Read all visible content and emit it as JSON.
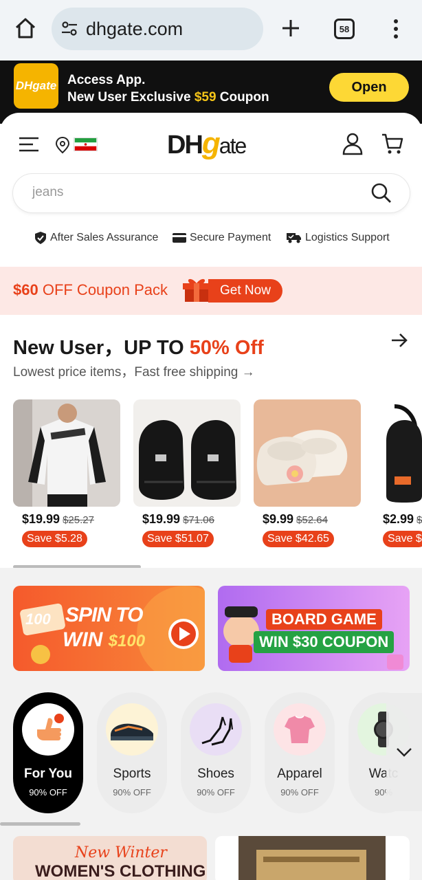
{
  "browser": {
    "url": "dhgate.com",
    "tab_count": "58"
  },
  "app_banner": {
    "logo_text": "DHgate",
    "line1": "Access App.",
    "line2_prefix": "New User Exclusive ",
    "line2_amount": "$59",
    "line2_suffix": " Coupon",
    "open_label": "Open"
  },
  "header": {
    "logo_dh": "DH",
    "logo_g": "g",
    "logo_ate": "ate",
    "search_placeholder": "jeans",
    "assurances": [
      "After Sales Assurance",
      "Secure Payment",
      "Logistics Support"
    ]
  },
  "coupon_strip": {
    "amount": "$60",
    "text": " OFF Coupon Pack",
    "cta": "Get Now"
  },
  "new_user": {
    "title_prefix": "New User，UP TO ",
    "title_pct": "50% Off",
    "subtitle": "Lowest price items，Fast free shipping →",
    "products": [
      {
        "price": "$19.99",
        "orig": "$25.27",
        "save": "Save $5.28"
      },
      {
        "price": "$19.99",
        "orig": "$71.06",
        "save": "Save $51.07"
      },
      {
        "price": "$9.99",
        "orig": "$52.64",
        "save": "Save $42.65"
      },
      {
        "price": "$2.99",
        "orig": "$",
        "save": "Save $"
      }
    ]
  },
  "promos": {
    "spin_badge": "100",
    "spin_line1": "SPIN TO",
    "spin_line2": "WIN",
    "spin_amount": "$100",
    "board_line1": "BOARD GAME",
    "board_line2": "WIN $30 COUPON"
  },
  "categories": [
    {
      "name": "For You",
      "off": "90% OFF"
    },
    {
      "name": "Sports",
      "off": "90% OFF"
    },
    {
      "name": "Shoes",
      "off": "90% OFF"
    },
    {
      "name": "Apparel",
      "off": "90% OFF"
    },
    {
      "name": "Watc",
      "off": "90% "
    }
  ],
  "bottom": {
    "card1_line1": "New Winter",
    "card1_line2": "WOMEN'S CLOTHING"
  },
  "colors": {
    "accent": "#e8411a",
    "brand_yellow": "#f5b400",
    "open_button": "#fdd835"
  },
  "icons": [
    "home-icon",
    "tune-icon",
    "plus-icon",
    "tabs-icon",
    "more-vert-icon",
    "menu-icon",
    "location-icon",
    "flag-iran",
    "user-icon",
    "cart-icon",
    "search-icon",
    "shield-icon",
    "card-icon",
    "truck-icon",
    "gift-icon",
    "arrow-right-icon",
    "chevron-down-icon"
  ]
}
